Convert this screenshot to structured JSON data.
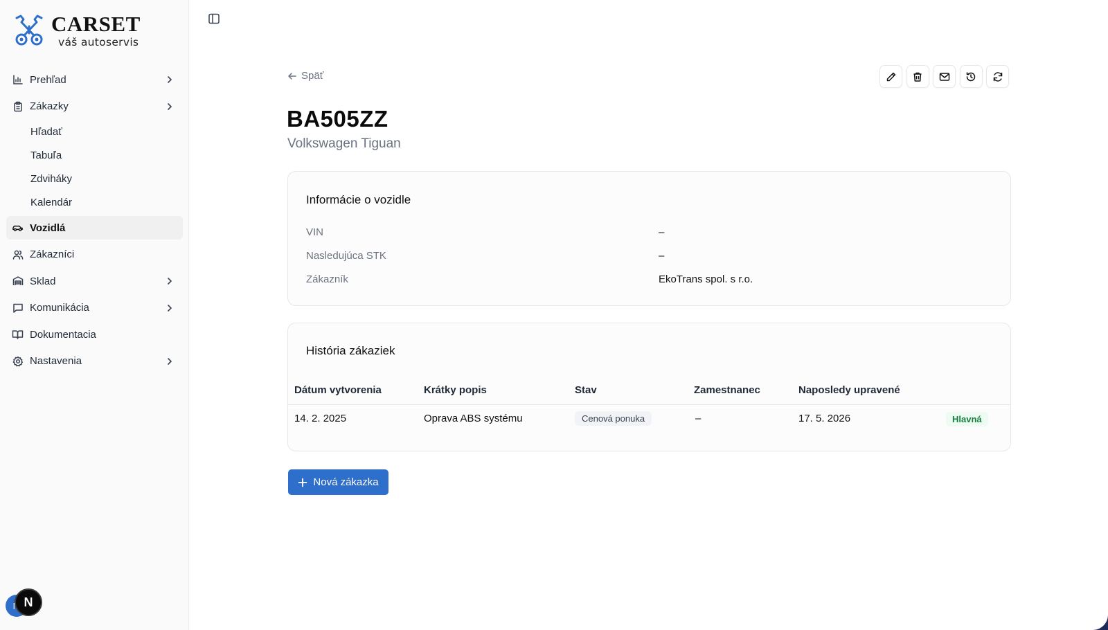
{
  "brand": {
    "title": "CARSET",
    "subtitle": "váš autoservis",
    "accent": "#2e6fcb"
  },
  "sidebar": {
    "items": [
      {
        "label": "Prehľad",
        "icon": "bar-chart-icon",
        "has_chevron": true
      },
      {
        "label": "Zákazky",
        "icon": "clipboard-icon",
        "has_chevron": true
      },
      {
        "label": "Vozidlá",
        "icon": "car-icon",
        "active": true
      },
      {
        "label": "Zákazníci",
        "icon": "users-icon"
      },
      {
        "label": "Sklad",
        "icon": "warehouse-icon",
        "has_chevron": true
      },
      {
        "label": "Komunikácia",
        "icon": "message-icon",
        "has_chevron": true
      },
      {
        "label": "Dokumentacia",
        "icon": "book-icon"
      },
      {
        "label": "Nastavenia",
        "icon": "gear-icon",
        "has_chevron": true
      }
    ],
    "subitems": [
      "Hľadať",
      "Tabuľa",
      "Zdviháky",
      "Kalendár"
    ],
    "avatar_initial": "M",
    "dev_badge": "N"
  },
  "header": {
    "back_label": "Späť"
  },
  "vehicle": {
    "plate": "BA505ZZ",
    "model": "Volkswagen Tiguan"
  },
  "info_card": {
    "title": "Informácie o vozidle",
    "rows": [
      {
        "label": "VIN",
        "value": "–"
      },
      {
        "label": "Nasledujúca STK",
        "value": "–"
      },
      {
        "label": "Zákazník",
        "value": "EkoTrans spol. s r.o."
      }
    ]
  },
  "history_card": {
    "title": "História zákaziek",
    "columns": [
      "Dátum vytvorenia",
      "Krátky popis",
      "Stav",
      "Zamestnanec",
      "Naposledy upravené"
    ],
    "rows": [
      {
        "date": "14. 2. 2025",
        "description": "Oprava ABS systému",
        "status": "Cenová ponuka",
        "employee": "–",
        "updated": "17. 5. 2026",
        "tag": "Hlavná"
      }
    ]
  },
  "new_order_label": "Nová zákazka"
}
